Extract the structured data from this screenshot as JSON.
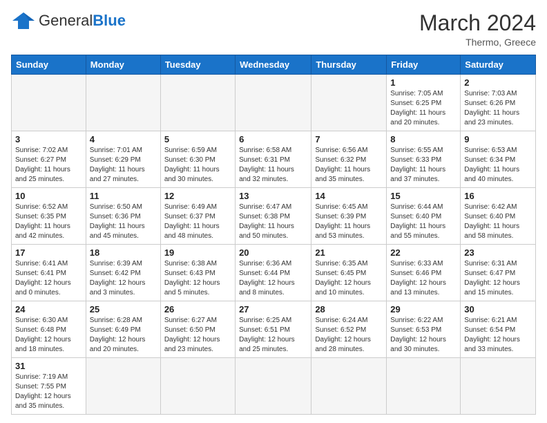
{
  "header": {
    "logo_general": "General",
    "logo_blue": "Blue",
    "month": "March 2024",
    "location": "Thermo, Greece"
  },
  "weekdays": [
    "Sunday",
    "Monday",
    "Tuesday",
    "Wednesday",
    "Thursday",
    "Friday",
    "Saturday"
  ],
  "weeks": [
    [
      {
        "day": "",
        "info": ""
      },
      {
        "day": "",
        "info": ""
      },
      {
        "day": "",
        "info": ""
      },
      {
        "day": "",
        "info": ""
      },
      {
        "day": "",
        "info": ""
      },
      {
        "day": "1",
        "info": "Sunrise: 7:05 AM\nSunset: 6:25 PM\nDaylight: 11 hours\nand 20 minutes."
      },
      {
        "day": "2",
        "info": "Sunrise: 7:03 AM\nSunset: 6:26 PM\nDaylight: 11 hours\nand 23 minutes."
      }
    ],
    [
      {
        "day": "3",
        "info": "Sunrise: 7:02 AM\nSunset: 6:27 PM\nDaylight: 11 hours\nand 25 minutes."
      },
      {
        "day": "4",
        "info": "Sunrise: 7:01 AM\nSunset: 6:29 PM\nDaylight: 11 hours\nand 27 minutes."
      },
      {
        "day": "5",
        "info": "Sunrise: 6:59 AM\nSunset: 6:30 PM\nDaylight: 11 hours\nand 30 minutes."
      },
      {
        "day": "6",
        "info": "Sunrise: 6:58 AM\nSunset: 6:31 PM\nDaylight: 11 hours\nand 32 minutes."
      },
      {
        "day": "7",
        "info": "Sunrise: 6:56 AM\nSunset: 6:32 PM\nDaylight: 11 hours\nand 35 minutes."
      },
      {
        "day": "8",
        "info": "Sunrise: 6:55 AM\nSunset: 6:33 PM\nDaylight: 11 hours\nand 37 minutes."
      },
      {
        "day": "9",
        "info": "Sunrise: 6:53 AM\nSunset: 6:34 PM\nDaylight: 11 hours\nand 40 minutes."
      }
    ],
    [
      {
        "day": "10",
        "info": "Sunrise: 6:52 AM\nSunset: 6:35 PM\nDaylight: 11 hours\nand 42 minutes."
      },
      {
        "day": "11",
        "info": "Sunrise: 6:50 AM\nSunset: 6:36 PM\nDaylight: 11 hours\nand 45 minutes."
      },
      {
        "day": "12",
        "info": "Sunrise: 6:49 AM\nSunset: 6:37 PM\nDaylight: 11 hours\nand 48 minutes."
      },
      {
        "day": "13",
        "info": "Sunrise: 6:47 AM\nSunset: 6:38 PM\nDaylight: 11 hours\nand 50 minutes."
      },
      {
        "day": "14",
        "info": "Sunrise: 6:45 AM\nSunset: 6:39 PM\nDaylight: 11 hours\nand 53 minutes."
      },
      {
        "day": "15",
        "info": "Sunrise: 6:44 AM\nSunset: 6:40 PM\nDaylight: 11 hours\nand 55 minutes."
      },
      {
        "day": "16",
        "info": "Sunrise: 6:42 AM\nSunset: 6:40 PM\nDaylight: 11 hours\nand 58 minutes."
      }
    ],
    [
      {
        "day": "17",
        "info": "Sunrise: 6:41 AM\nSunset: 6:41 PM\nDaylight: 12 hours\nand 0 minutes."
      },
      {
        "day": "18",
        "info": "Sunrise: 6:39 AM\nSunset: 6:42 PM\nDaylight: 12 hours\nand 3 minutes."
      },
      {
        "day": "19",
        "info": "Sunrise: 6:38 AM\nSunset: 6:43 PM\nDaylight: 12 hours\nand 5 minutes."
      },
      {
        "day": "20",
        "info": "Sunrise: 6:36 AM\nSunset: 6:44 PM\nDaylight: 12 hours\nand 8 minutes."
      },
      {
        "day": "21",
        "info": "Sunrise: 6:35 AM\nSunset: 6:45 PM\nDaylight: 12 hours\nand 10 minutes."
      },
      {
        "day": "22",
        "info": "Sunrise: 6:33 AM\nSunset: 6:46 PM\nDaylight: 12 hours\nand 13 minutes."
      },
      {
        "day": "23",
        "info": "Sunrise: 6:31 AM\nSunset: 6:47 PM\nDaylight: 12 hours\nand 15 minutes."
      }
    ],
    [
      {
        "day": "24",
        "info": "Sunrise: 6:30 AM\nSunset: 6:48 PM\nDaylight: 12 hours\nand 18 minutes."
      },
      {
        "day": "25",
        "info": "Sunrise: 6:28 AM\nSunset: 6:49 PM\nDaylight: 12 hours\nand 20 minutes."
      },
      {
        "day": "26",
        "info": "Sunrise: 6:27 AM\nSunset: 6:50 PM\nDaylight: 12 hours\nand 23 minutes."
      },
      {
        "day": "27",
        "info": "Sunrise: 6:25 AM\nSunset: 6:51 PM\nDaylight: 12 hours\nand 25 minutes."
      },
      {
        "day": "28",
        "info": "Sunrise: 6:24 AM\nSunset: 6:52 PM\nDaylight: 12 hours\nand 28 minutes."
      },
      {
        "day": "29",
        "info": "Sunrise: 6:22 AM\nSunset: 6:53 PM\nDaylight: 12 hours\nand 30 minutes."
      },
      {
        "day": "30",
        "info": "Sunrise: 6:21 AM\nSunset: 6:54 PM\nDaylight: 12 hours\nand 33 minutes."
      }
    ],
    [
      {
        "day": "31",
        "info": "Sunrise: 7:19 AM\nSunset: 7:55 PM\nDaylight: 12 hours\nand 35 minutes."
      },
      {
        "day": "",
        "info": ""
      },
      {
        "day": "",
        "info": ""
      },
      {
        "day": "",
        "info": ""
      },
      {
        "day": "",
        "info": ""
      },
      {
        "day": "",
        "info": ""
      },
      {
        "day": "",
        "info": ""
      }
    ]
  ]
}
